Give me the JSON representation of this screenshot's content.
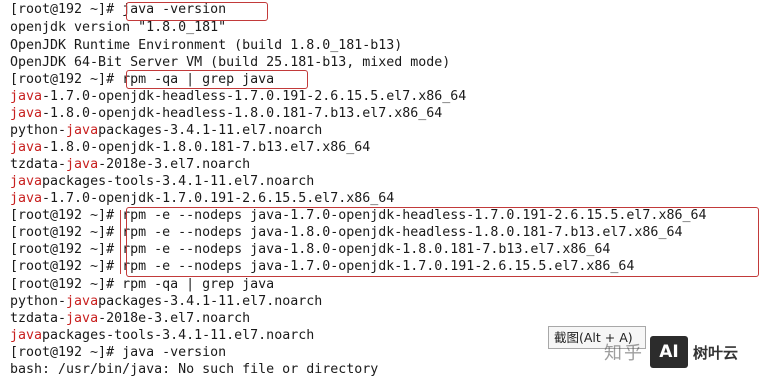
{
  "terminal": {
    "lines": [
      {
        "prompt": "[root@192 ~]# ",
        "cmd": "java -version"
      },
      {
        "text": "openjdk version \"1.8.0_181\""
      },
      {
        "text": "OpenJDK Runtime Environment (build 1.8.0_181-b13)"
      },
      {
        "text": "OpenJDK 64-Bit Server VM (build 25.181-b13, mixed mode)"
      },
      {
        "prompt": "[root@192 ~]# ",
        "cmd": "rpm -qa | grep java"
      },
      {
        "pre": "",
        "hl": "java",
        "post": "-1.7.0-openjdk-headless-1.7.0.191-2.6.15.5.el7.x86_64"
      },
      {
        "pre": "",
        "hl": "java",
        "post": "-1.8.0-openjdk-headless-1.8.0.181-7.b13.el7.x86_64"
      },
      {
        "pre": "python-",
        "hl": "java",
        "post": "packages-3.4.1-11.el7.noarch"
      },
      {
        "pre": "",
        "hl": "java",
        "post": "-1.8.0-openjdk-1.8.0.181-7.b13.el7.x86_64"
      },
      {
        "pre": "tzdata-",
        "hl": "java",
        "post": "-2018e-3.el7.noarch"
      },
      {
        "pre": "",
        "hl": "java",
        "post": "packages-tools-3.4.1-11.el7.noarch"
      },
      {
        "pre": "",
        "hl": "java",
        "post": "-1.7.0-openjdk-1.7.0.191-2.6.15.5.el7.x86_64"
      },
      {
        "prompt": "[root@192 ~]# ",
        "cmd": "rpm -e --nodeps java-1.7.0-openjdk-headless-1.7.0.191-2.6.15.5.el7.x86_64"
      },
      {
        "prompt": "[root@192 ~]# ",
        "cmd": "rpm -e --nodeps java-1.8.0-openjdk-headless-1.8.0.181-7.b13.el7.x86_64"
      },
      {
        "prompt": "[root@192 ~]# ",
        "cmd": "rpm -e --nodeps java-1.8.0-openjdk-1.8.0.181-7.b13.el7.x86_64"
      },
      {
        "prompt": "[root@192 ~]# ",
        "cmd": "rpm -e --nodeps java-1.7.0-openjdk-1.7.0.191-2.6.15.5.el7.x86_64"
      },
      {
        "prompt": "[root@192 ~]# ",
        "cmd": "rpm -qa | grep java"
      },
      {
        "pre": "python-",
        "hl": "java",
        "post": "packages-3.4.1-11.el7.noarch"
      },
      {
        "pre": "tzdata-",
        "hl": "java",
        "post": "-2018e-3.el7.noarch"
      },
      {
        "pre": "",
        "hl": "java",
        "post": "packages-tools-3.4.1-11.el7.noarch"
      },
      {
        "prompt": "[root@192 ~]# ",
        "cmd": "java -version"
      },
      {
        "text": "bash: /usr/bin/java: No such file or directory"
      }
    ]
  },
  "tooltip": {
    "text": "截图(Alt + A)"
  },
  "watermark": {
    "zhihu": "知乎",
    "logo_text": "AI",
    "brand": "树叶云"
  },
  "colors": {
    "highlight": "#c8201f",
    "box_border": "#c23a3a",
    "text": "#1a1a1a"
  }
}
